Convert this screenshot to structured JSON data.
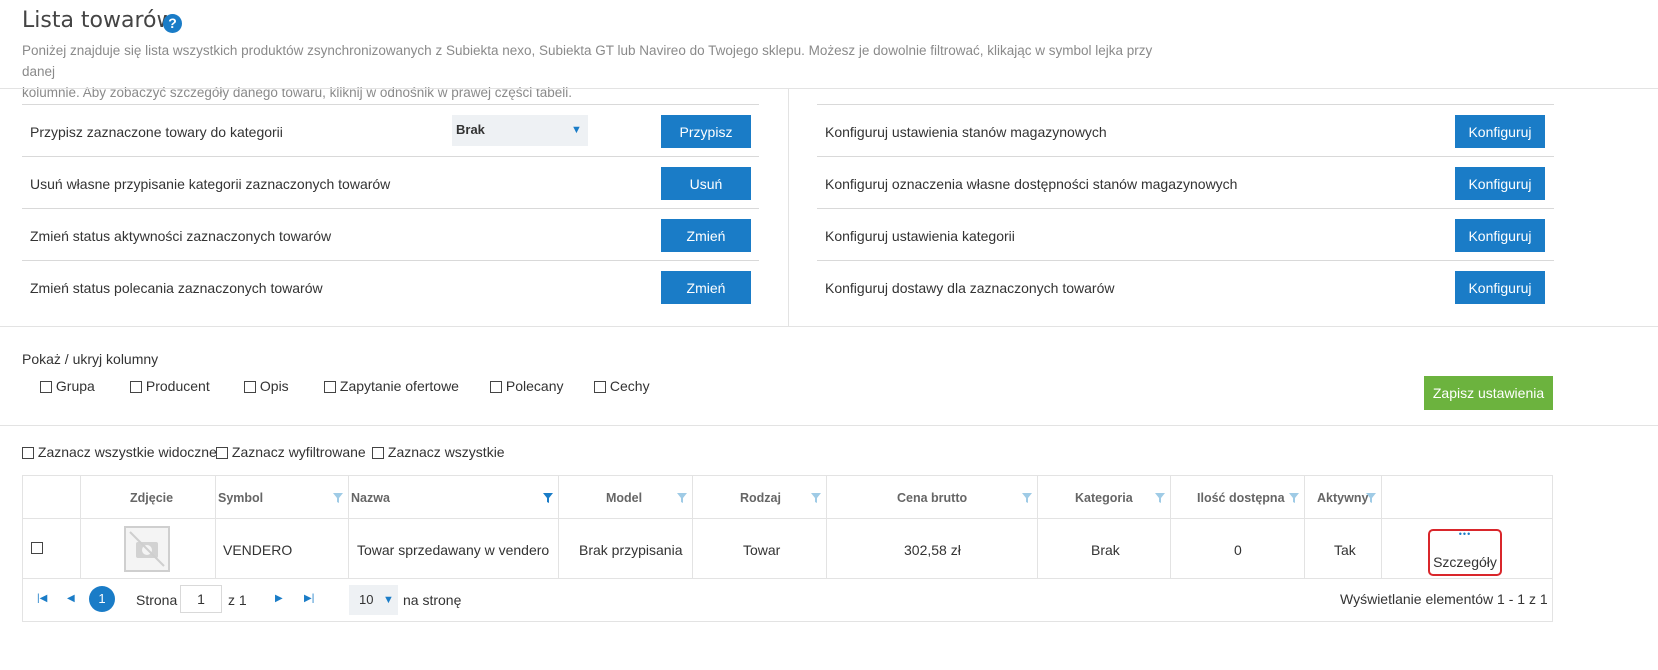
{
  "header": {
    "title": "Lista towarów",
    "help_icon": "?",
    "description_line1": "Poniżej znajduje się lista wszystkich produktów zsynchronizowanych z Subiekta nexo, Subiekta GT lub Navireo do Twojego sklepu. Możesz je dowolnie filtrować, klikając w symbol lejka przy danej",
    "description_line2": "kolumnie. Aby zobaczyć szczegóły danego towaru, kliknij w odnośnik w prawej części tabeli."
  },
  "left_actions": [
    {
      "label": "Przypisz zaznaczone towary do kategorii",
      "button": "Przypisz",
      "select_value": "Brak"
    },
    {
      "label": "Usuń własne przypisanie kategorii zaznaczonych towarów",
      "button": "Usuń"
    },
    {
      "label": "Zmień status aktywności zaznaczonych towarów",
      "button": "Zmień"
    },
    {
      "label": "Zmień status polecania zaznaczonych towarów",
      "button": "Zmień"
    }
  ],
  "right_actions": [
    {
      "label": "Konfiguruj ustawienia stanów magazynowych",
      "button": "Konfiguruj"
    },
    {
      "label": "Konfiguruj oznaczenia własne dostępności stanów magazynowych",
      "button": "Konfiguruj"
    },
    {
      "label": "Konfiguruj ustawienia kategorii",
      "button": "Konfiguruj"
    },
    {
      "label": "Konfiguruj dostawy dla zaznaczonych towarów",
      "button": "Konfiguruj"
    }
  ],
  "columns_toggle": {
    "heading": "Pokaż / ukryj kolumny",
    "options": [
      "Grupa",
      "Producent",
      "Opis",
      "Zapytanie ofertowe",
      "Polecany",
      "Cechy"
    ],
    "save_button": "Zapisz ustawienia"
  },
  "select_options": [
    "Zaznacz wszystkie widoczne",
    "Zaznacz wyfiltrowane",
    "Zaznacz wszystkie"
  ],
  "table": {
    "headers": [
      "Zdjęcie",
      "Symbol",
      "Nazwa",
      "Model",
      "Rodzaj",
      "Cena brutto",
      "Kategoria",
      "Ilość dostępna",
      "Aktywny"
    ],
    "row": {
      "symbol": "VENDERO",
      "nazwa": "Towar sprzedawany w vendero",
      "model": "Brak przypisania",
      "rodzaj": "Towar",
      "cena": "302,58 zł",
      "kategoria": "Brak",
      "ilosc": "0",
      "aktywny": "Tak",
      "details_dots": "•••",
      "details_label": "Szczegóły"
    }
  },
  "pager": {
    "current_page": "1",
    "page_label": "Strona",
    "page_input": "1",
    "of_label": "z 1",
    "page_size": "10",
    "per_page_label": "na stronę",
    "summary": "Wyświetlanie elementów 1 - 1 z 1"
  },
  "colors": {
    "primary": "#1a7cc7",
    "success": "#6cb33e",
    "highlight": "#d9262b"
  },
  "icons": [
    "help-icon",
    "filter-icon",
    "no-image-icon",
    "first-page-icon",
    "prev-page-icon",
    "next-page-icon",
    "last-page-icon",
    "caret-down-icon"
  ]
}
